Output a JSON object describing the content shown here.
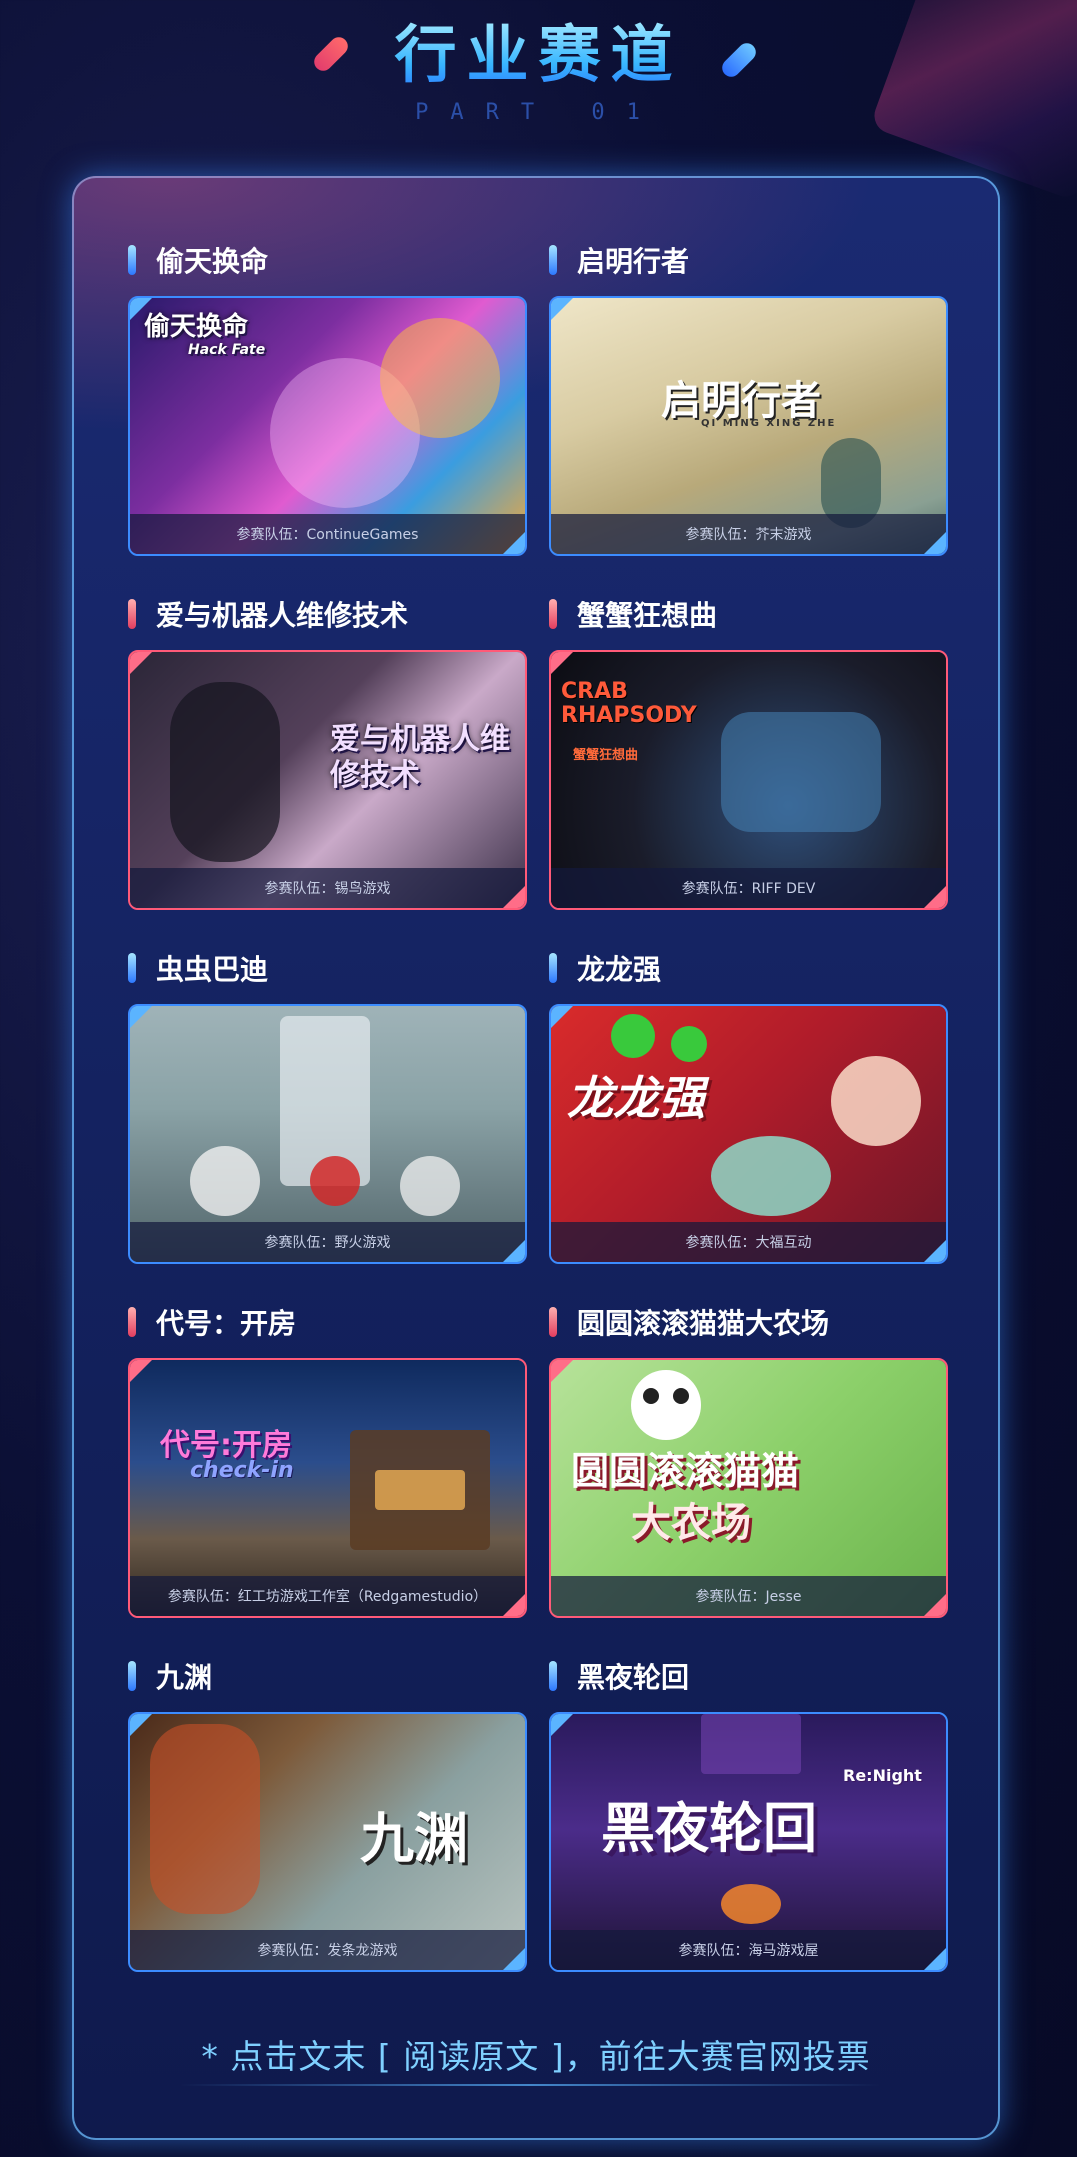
{
  "header": {
    "title": "行业赛道",
    "subtitle": "PART 01"
  },
  "games": [
    {
      "title": "偷天换命",
      "team": "参赛队伍：ContinueGames",
      "logo": "偷天换命",
      "logo_sub": "Hack Fate",
      "theme": "blue"
    },
    {
      "title": "启明行者",
      "team": "参赛队伍：芥末游戏",
      "logo": "启明行者",
      "logo_sub": "QI MING XING ZHE",
      "theme": "blue"
    },
    {
      "title": "爱与机器人维修技术",
      "team": "参赛队伍：锡鸟游戏",
      "logo": "爱与机器人维修技术",
      "logo_sub": "",
      "theme": "red"
    },
    {
      "title": "蟹蟹狂想曲",
      "team": "参赛队伍：RIFF DEV",
      "logo": "CRAB RHAPSODY",
      "logo_sub": "蟹蟹狂想曲",
      "theme": "red"
    },
    {
      "title": "虫虫巴迪",
      "team": "参赛队伍：野火游戏",
      "logo": "",
      "logo_sub": "",
      "theme": "blue"
    },
    {
      "title": "龙龙强",
      "team": "参赛队伍：大福互动",
      "logo": "龙龙强",
      "logo_sub": "",
      "theme": "blue"
    },
    {
      "title": "代号：开房",
      "team": "参赛队伍：红工坊游戏工作室（Redgamestudio）",
      "logo": "代号:开房",
      "logo_sub": "check-in",
      "theme": "red"
    },
    {
      "title": "圆圆滚滚猫猫大农场",
      "team": "参赛队伍：Jesse",
      "logo": "圆圆滚滚猫猫",
      "logo_sub": "大农场",
      "theme": "red"
    },
    {
      "title": "九渊",
      "team": "参赛队伍：发条龙游戏",
      "logo": "九渊",
      "logo_sub": "",
      "theme": "blue"
    },
    {
      "title": "黑夜轮回",
      "team": "参赛队伍：海马游戏屋",
      "logo": "黑夜轮回",
      "logo_sub": "Re:Night",
      "theme": "blue"
    }
  ],
  "footer": {
    "note": "* 点击文末 [ 阅读原文 ]，前往大赛官网投票"
  }
}
